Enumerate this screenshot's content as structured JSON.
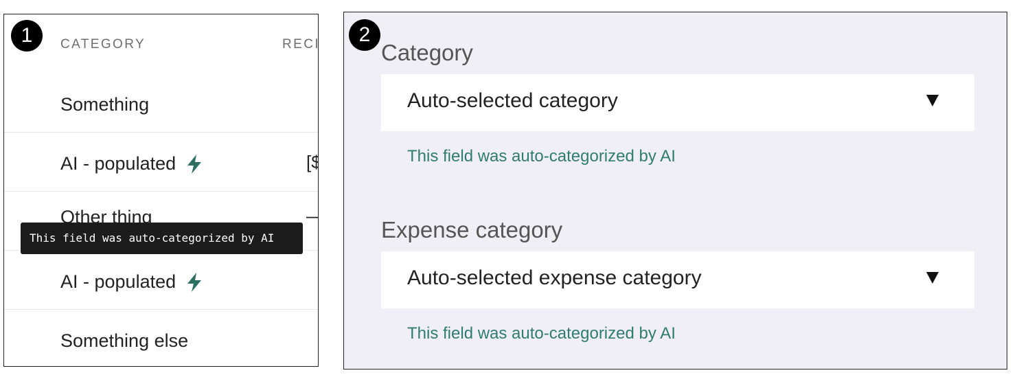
{
  "panel1": {
    "badge": "1",
    "header": {
      "category": "CATEGORY",
      "next_column": "RECI"
    },
    "rows": [
      {
        "label": "Something",
        "ai": false,
        "aux": ""
      },
      {
        "label": "AI - populated",
        "ai": true,
        "aux": "[$"
      },
      {
        "label": "Other thing",
        "ai": false,
        "aux": "—"
      },
      {
        "label": "AI - populated",
        "ai": true,
        "aux": ""
      },
      {
        "label": "Something else",
        "ai": false,
        "aux": ""
      }
    ],
    "tooltip": "This field was auto-categorized by AI",
    "bolt_color": "#2d6e63"
  },
  "panel2": {
    "badge": "2",
    "fields": [
      {
        "label": "Category",
        "value": "Auto-selected category",
        "helper": "This field was auto-categorized by AI"
      },
      {
        "label": "Expense category",
        "value": "Auto-selected expense category",
        "helper": "This field was auto-categorized by AI"
      }
    ],
    "background": "#f0eff5",
    "helper_color": "#2f7d6f"
  }
}
